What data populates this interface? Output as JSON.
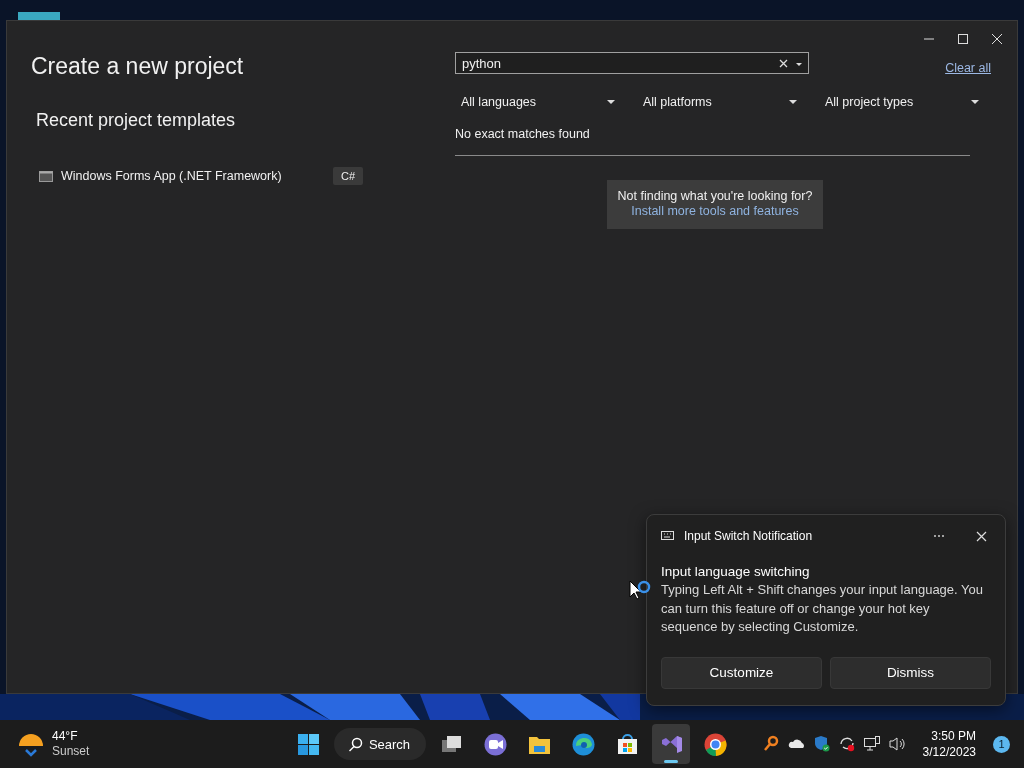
{
  "window": {
    "title": "Create a new project"
  },
  "recent": {
    "heading": "Recent project templates",
    "items": [
      {
        "name": "Windows Forms App (.NET Framework)",
        "language": "C#"
      }
    ]
  },
  "search": {
    "value": "python"
  },
  "clear_all": "Clear all",
  "filters": [
    {
      "label": "All languages"
    },
    {
      "label": "All platforms"
    },
    {
      "label": "All project types"
    }
  ],
  "results_message": "No exact matches found",
  "help": {
    "question": "Not finding what you're looking for?",
    "link": "Install more tools and features"
  },
  "notification": {
    "app": "Input Switch Notification",
    "title": "Input language switching",
    "body": "Typing Left Alt + Shift changes your input language. You can turn this feature off or change your hot key sequence by selecting Customize.",
    "buttons": [
      "Customize",
      "Dismiss"
    ]
  },
  "taskbar": {
    "weather": {
      "temperature": "44°F",
      "condition": "Sunset"
    },
    "search_label": "Search",
    "apps": [
      {
        "kind": "start",
        "active": false
      },
      {
        "kind": "search",
        "active": false
      },
      {
        "kind": "taskview",
        "active": false
      },
      {
        "kind": "chat",
        "active": false
      },
      {
        "kind": "explorer",
        "active": false
      },
      {
        "kind": "edge",
        "active": false
      },
      {
        "kind": "store",
        "active": false
      },
      {
        "kind": "vs",
        "active": true
      },
      {
        "kind": "chrome",
        "active": false
      }
    ],
    "tray": [
      {
        "kind": "magnifier"
      },
      {
        "kind": "cloud"
      },
      {
        "kind": "shield"
      },
      {
        "kind": "sync"
      },
      {
        "kind": "network"
      },
      {
        "kind": "volume"
      }
    ],
    "time": "3:50 PM",
    "date": "3/12/2023",
    "badge": "1"
  }
}
